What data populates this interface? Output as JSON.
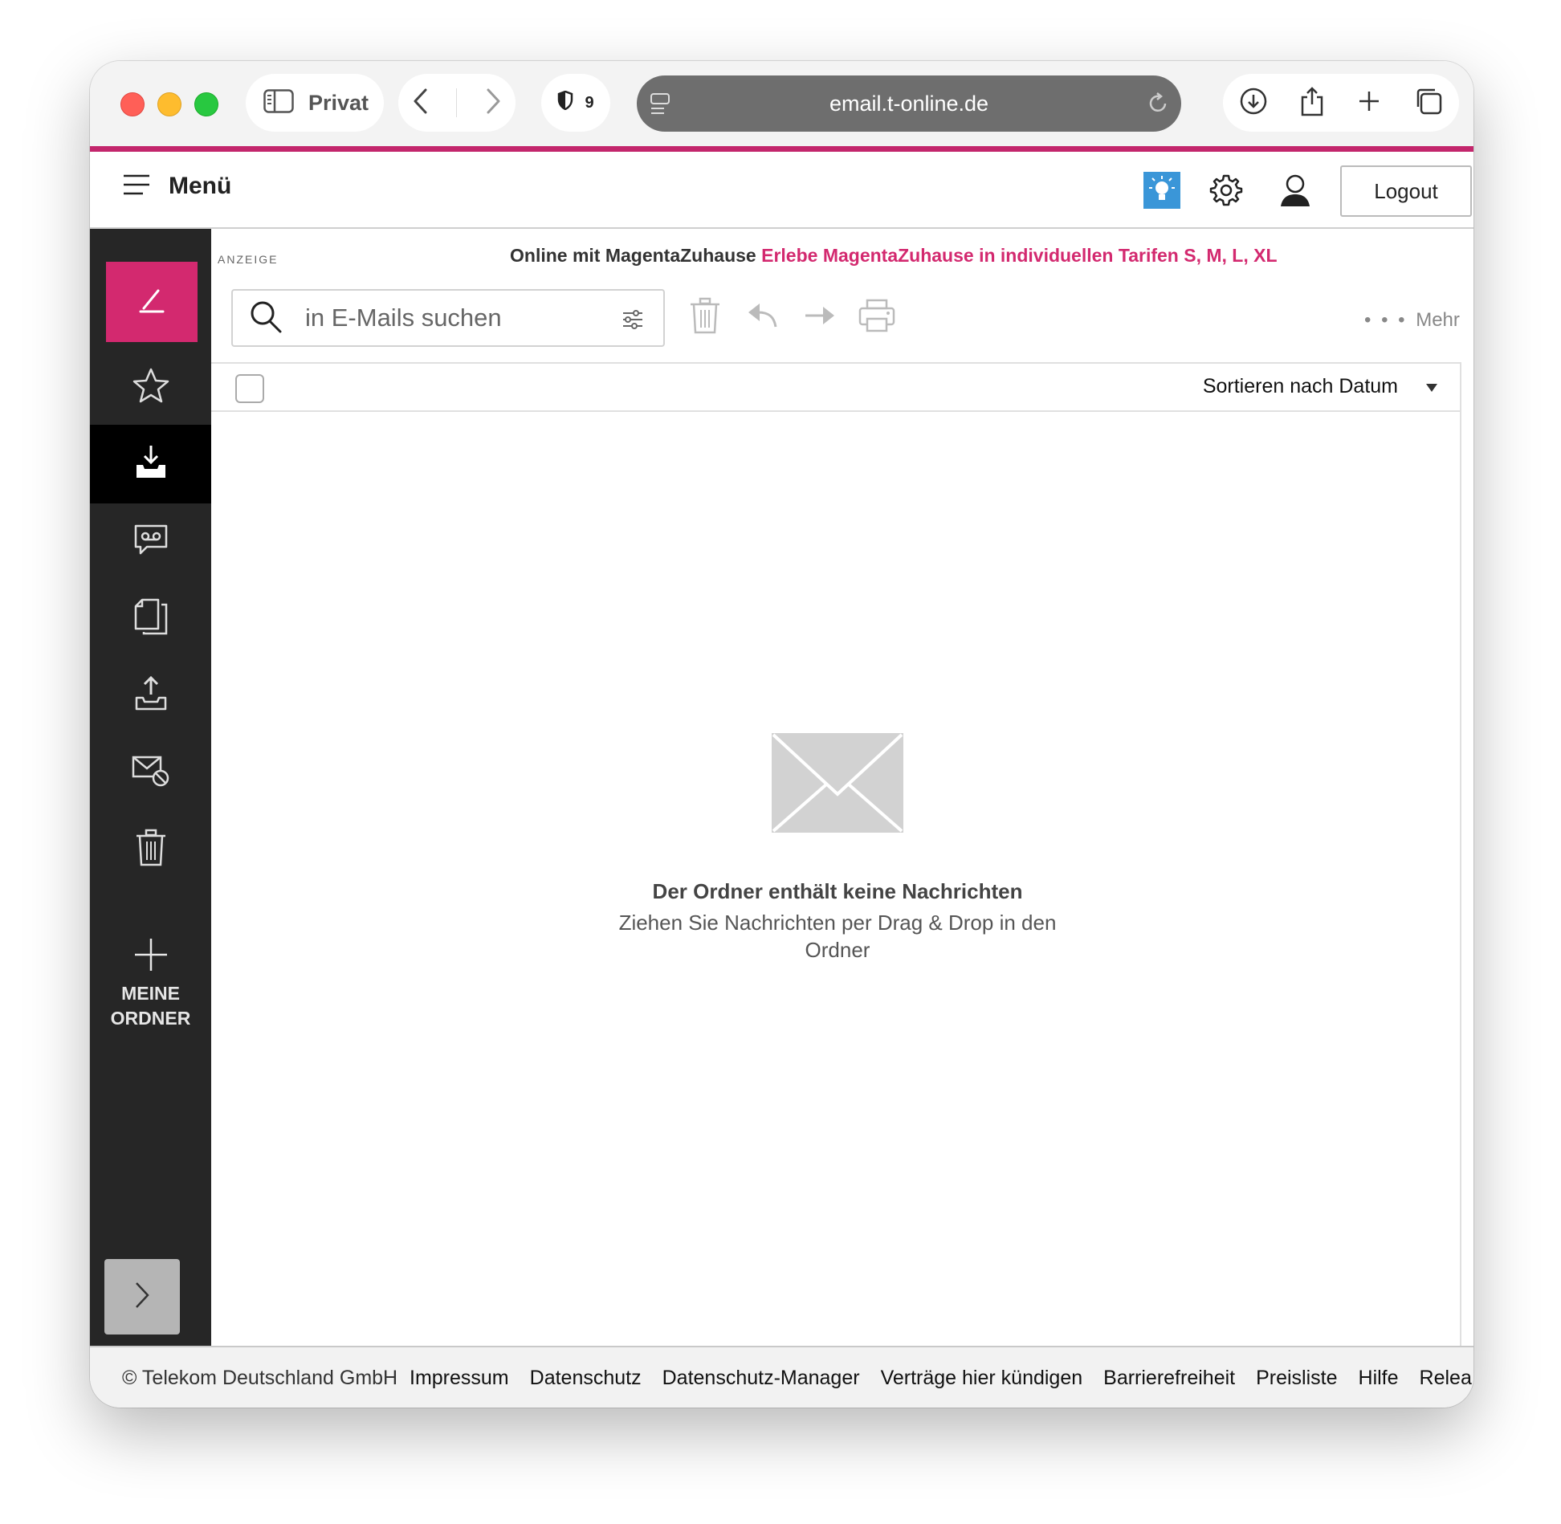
{
  "browser": {
    "profile_label": "Privat",
    "shield_count": "9",
    "url": "email.t-online.de"
  },
  "header": {
    "menu_label": "Menü",
    "logout_label": "Logout"
  },
  "sidebar": {
    "add_folder_line1": "MEINE",
    "add_folder_line2": "ORDNER"
  },
  "ad": {
    "label": "ANZEIGE",
    "text_dark": "Online mit MagentaZuhause",
    "text_pink": "Erlebe MagentaZuhause in individuellen Tarifen S, M, L, XL"
  },
  "search": {
    "placeholder": "in E-Mails suchen"
  },
  "toolbar": {
    "more_dots": "• • •",
    "more_label": "Mehr"
  },
  "list": {
    "sort_label": "Sortieren nach Datum"
  },
  "empty_state": {
    "title": "Der Ordner enthält keine Nachrichten",
    "subtitle_line1": "Ziehen Sie Nachrichten per Drag & Drop in den",
    "subtitle_line2": "Ordner"
  },
  "footer": {
    "copyright": "© Telekom Deutschland GmbH",
    "links": [
      "Impressum",
      "Datenschutz",
      "Datenschutz-Manager",
      "Verträge hier kündigen",
      "Barrierefreiheit",
      "Preisliste",
      "Hilfe",
      "Relea"
    ]
  },
  "colors": {
    "brand_magenta": "#d3296f",
    "sidebar_bg": "#262626",
    "bulb_blue": "#3a96d8"
  },
  "icons": {
    "sidebar": [
      "compose-icon",
      "favorites-star-icon",
      "inbox-icon",
      "voicemail-icon",
      "drafts-icon",
      "sent-icon",
      "spam-icon",
      "trash-icon",
      "add-folder-plus-icon",
      "expand-chevron-icon"
    ],
    "header": [
      "menu-hamburger-icon",
      "tips-bulb-icon",
      "settings-gear-icon",
      "account-user-icon"
    ],
    "toolbar": [
      "delete-icon",
      "reply-icon",
      "forward-icon",
      "print-icon"
    ]
  }
}
